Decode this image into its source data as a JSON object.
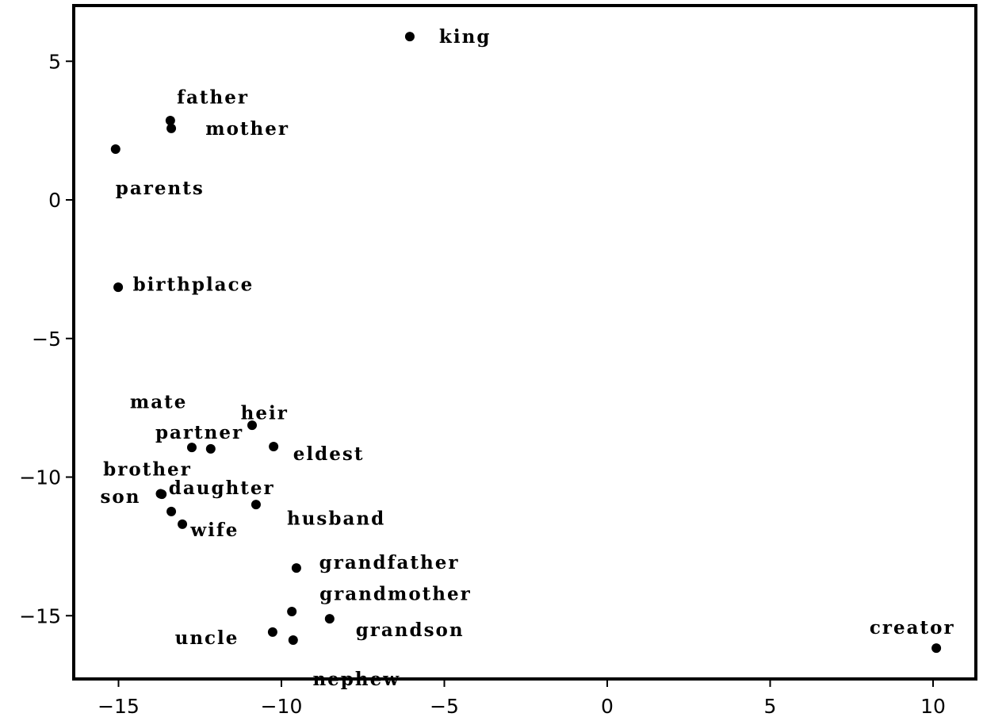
{
  "chart_data": {
    "type": "scatter",
    "title": "",
    "xlabel": "",
    "ylabel": "",
    "xlim": [
      -16.4,
      11.3
    ],
    "ylim": [
      -17.2,
      7.0
    ],
    "grid": false,
    "legend": null,
    "x_ticks": [
      -15,
      -10,
      -5,
      0,
      5,
      10
    ],
    "x_tick_labels": [
      "−15",
      "−10",
      "−5",
      "0",
      "5",
      "10"
    ],
    "y_ticks": [
      5,
      0,
      -5,
      -10,
      -15
    ],
    "y_tick_labels": [
      "5",
      "0",
      "−5",
      "−10",
      "−15"
    ],
    "points": [
      {
        "label": "king",
        "x": -6.06,
        "y": 5.89,
        "label_dx": 0.9,
        "label_dy": 0.0
      },
      {
        "label": "father",
        "x": -13.41,
        "y": 2.86,
        "label_dx": 0.2,
        "label_dy": 0.85
      },
      {
        "label": "mother",
        "x": -13.38,
        "y": 2.58,
        "label_dx": 1.05,
        "label_dy": 0.0
      },
      {
        "label": "parents",
        "x": -15.09,
        "y": 1.83,
        "label_dx": 0.0,
        "label_dy": -1.4
      },
      {
        "label": "birthplace",
        "x": -15.01,
        "y": -3.15,
        "label_dx": 0.45,
        "label_dy": 0.1
      },
      {
        "label": "mate",
        "x": -12.75,
        "y": -8.93,
        "label_dx": -1.9,
        "label_dy": 1.65
      },
      {
        "label": "heir",
        "x": -10.9,
        "y": -8.13,
        "label_dx": -0.35,
        "label_dy": 0.45
      },
      {
        "label": "partner",
        "x": -12.17,
        "y": -8.98,
        "label_dx": -1.7,
        "label_dy": 0.6
      },
      {
        "label": "eldest",
        "x": -10.24,
        "y": -8.9,
        "label_dx": 0.6,
        "label_dy": -0.25
      },
      {
        "label": "brother",
        "x": -13.67,
        "y": -10.62,
        "label_dx": -1.8,
        "label_dy": 0.9
      },
      {
        "label": "son",
        "x": -13.71,
        "y": -10.6,
        "label_dx": -1.85,
        "label_dy": -0.1
      },
      {
        "label": "daughter",
        "x": -13.38,
        "y": -11.24,
        "label_dx": -0.08,
        "label_dy": 0.85
      },
      {
        "label": "wife",
        "x": -13.04,
        "y": -11.7,
        "label_dx": 0.25,
        "label_dy": -0.2
      },
      {
        "label": "husband",
        "x": -10.78,
        "y": -10.99,
        "label_dx": 0.95,
        "label_dy": -0.5
      },
      {
        "label": "grandfather",
        "x": -9.54,
        "y": -13.28,
        "label_dx": 0.7,
        "label_dy": 0.2
      },
      {
        "label": "grandmother",
        "x": -9.68,
        "y": -14.85,
        "label_dx": 0.85,
        "label_dy": 0.65
      },
      {
        "label": "grandson",
        "x": -8.52,
        "y": -15.11,
        "label_dx": 0.8,
        "label_dy": -0.4
      },
      {
        "label": "uncle",
        "x": -10.27,
        "y": -15.59,
        "label_dx": -3.0,
        "label_dy": -0.2
      },
      {
        "label": "nephew",
        "x": -9.64,
        "y": -15.88,
        "label_dx": 0.6,
        "label_dy": -1.4
      },
      {
        "label": "creator",
        "x": 10.1,
        "y": -16.17,
        "label_dx": -2.05,
        "label_dy": 0.75
      }
    ]
  },
  "colors": {
    "marker": "#000000",
    "axis": "#000000",
    "background": "#ffffff"
  }
}
